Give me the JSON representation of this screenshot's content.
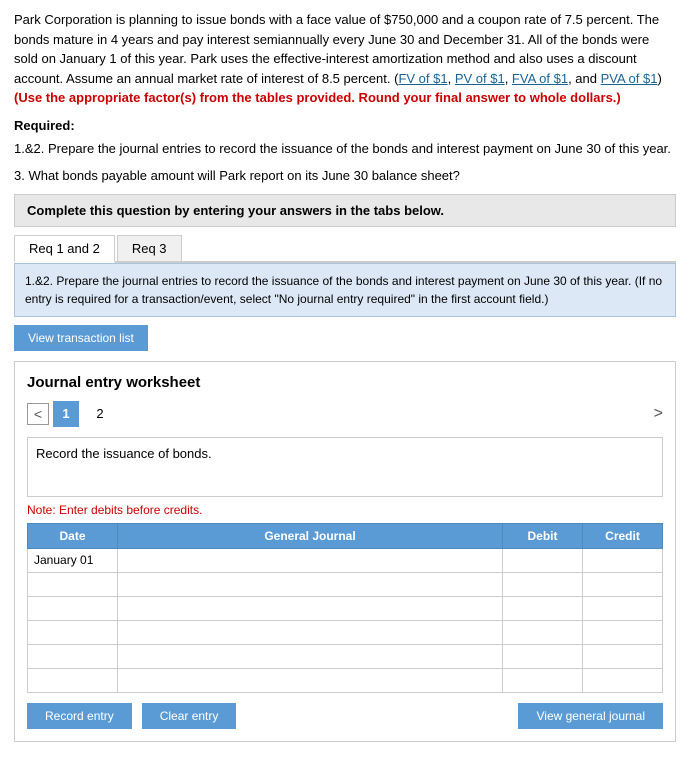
{
  "problem": {
    "text1": "Park Corporation is planning to issue bonds with a face value of $750,000 and a coupon rate of 7.5 percent. The bonds mature in 4 years and pay interest semiannually every June 30 and December 31. All of the bonds were sold on January 1 of this year. Park uses the effective-interest amortization method and also uses a discount account. Assume an annual market rate of interest of 8.5 percent. (",
    "links": [
      "FV of $1",
      "PV of $1",
      "FVA of $1",
      "PVA of $1"
    ],
    "text2": ") ",
    "bold_red": "(Use the appropriate factor(s) from the tables provided. Round your final answer to whole dollars.)"
  },
  "required_label": "Required:",
  "questions": [
    "1.&2. Prepare the journal entries to record the issuance of the bonds and interest payment on June 30 of this year.",
    "3. What bonds payable amount will Park report on its June 30 balance sheet?"
  ],
  "complete_banner": "Complete this question by entering your answers in the tabs below.",
  "tabs": [
    {
      "label": "Req 1 and 2",
      "active": true
    },
    {
      "label": "Req 3",
      "active": false
    }
  ],
  "instruction": "1.&2. Prepare the journal entries to record the issuance of the bonds and interest payment on June 30 of this year. (If no entry is required for a transaction/event, select \"No journal entry required\" in the first account field.)",
  "view_transaction_btn": "View transaction list",
  "journal": {
    "title": "Journal entry worksheet",
    "nav": {
      "prev_label": "<",
      "page1": "1",
      "page2": "2",
      "next_label": ">"
    },
    "record_box_text": "Record the issuance of bonds.",
    "note": "Note: Enter debits before credits.",
    "table": {
      "headers": [
        "Date",
        "General Journal",
        "Debit",
        "Credit"
      ],
      "rows": [
        {
          "date": "January 01",
          "journal": "",
          "debit": "",
          "credit": ""
        },
        {
          "date": "",
          "journal": "",
          "debit": "",
          "credit": ""
        },
        {
          "date": "",
          "journal": "",
          "debit": "",
          "credit": ""
        },
        {
          "date": "",
          "journal": "",
          "debit": "",
          "credit": ""
        },
        {
          "date": "",
          "journal": "",
          "debit": "",
          "credit": ""
        },
        {
          "date": "",
          "journal": "",
          "debit": "",
          "credit": ""
        }
      ]
    },
    "buttons": {
      "record": "Record entry",
      "clear": "Clear entry",
      "view": "View general journal"
    }
  }
}
